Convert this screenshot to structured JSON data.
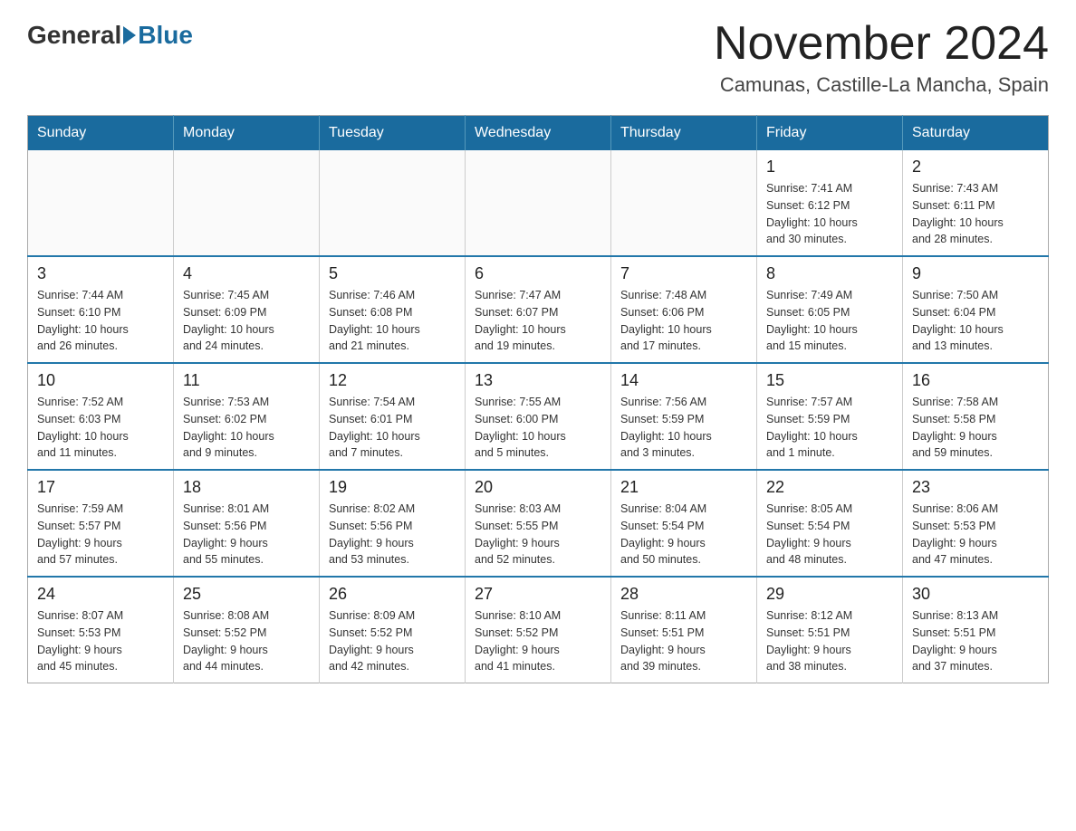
{
  "header": {
    "logo_general": "General",
    "logo_blue": "Blue",
    "month_title": "November 2024",
    "location": "Camunas, Castille-La Mancha, Spain"
  },
  "weekdays": [
    "Sunday",
    "Monday",
    "Tuesday",
    "Wednesday",
    "Thursday",
    "Friday",
    "Saturday"
  ],
  "weeks": [
    [
      {
        "day": "",
        "info": ""
      },
      {
        "day": "",
        "info": ""
      },
      {
        "day": "",
        "info": ""
      },
      {
        "day": "",
        "info": ""
      },
      {
        "day": "",
        "info": ""
      },
      {
        "day": "1",
        "info": "Sunrise: 7:41 AM\nSunset: 6:12 PM\nDaylight: 10 hours\nand 30 minutes."
      },
      {
        "day": "2",
        "info": "Sunrise: 7:43 AM\nSunset: 6:11 PM\nDaylight: 10 hours\nand 28 minutes."
      }
    ],
    [
      {
        "day": "3",
        "info": "Sunrise: 7:44 AM\nSunset: 6:10 PM\nDaylight: 10 hours\nand 26 minutes."
      },
      {
        "day": "4",
        "info": "Sunrise: 7:45 AM\nSunset: 6:09 PM\nDaylight: 10 hours\nand 24 minutes."
      },
      {
        "day": "5",
        "info": "Sunrise: 7:46 AM\nSunset: 6:08 PM\nDaylight: 10 hours\nand 21 minutes."
      },
      {
        "day": "6",
        "info": "Sunrise: 7:47 AM\nSunset: 6:07 PM\nDaylight: 10 hours\nand 19 minutes."
      },
      {
        "day": "7",
        "info": "Sunrise: 7:48 AM\nSunset: 6:06 PM\nDaylight: 10 hours\nand 17 minutes."
      },
      {
        "day": "8",
        "info": "Sunrise: 7:49 AM\nSunset: 6:05 PM\nDaylight: 10 hours\nand 15 minutes."
      },
      {
        "day": "9",
        "info": "Sunrise: 7:50 AM\nSunset: 6:04 PM\nDaylight: 10 hours\nand 13 minutes."
      }
    ],
    [
      {
        "day": "10",
        "info": "Sunrise: 7:52 AM\nSunset: 6:03 PM\nDaylight: 10 hours\nand 11 minutes."
      },
      {
        "day": "11",
        "info": "Sunrise: 7:53 AM\nSunset: 6:02 PM\nDaylight: 10 hours\nand 9 minutes."
      },
      {
        "day": "12",
        "info": "Sunrise: 7:54 AM\nSunset: 6:01 PM\nDaylight: 10 hours\nand 7 minutes."
      },
      {
        "day": "13",
        "info": "Sunrise: 7:55 AM\nSunset: 6:00 PM\nDaylight: 10 hours\nand 5 minutes."
      },
      {
        "day": "14",
        "info": "Sunrise: 7:56 AM\nSunset: 5:59 PM\nDaylight: 10 hours\nand 3 minutes."
      },
      {
        "day": "15",
        "info": "Sunrise: 7:57 AM\nSunset: 5:59 PM\nDaylight: 10 hours\nand 1 minute."
      },
      {
        "day": "16",
        "info": "Sunrise: 7:58 AM\nSunset: 5:58 PM\nDaylight: 9 hours\nand 59 minutes."
      }
    ],
    [
      {
        "day": "17",
        "info": "Sunrise: 7:59 AM\nSunset: 5:57 PM\nDaylight: 9 hours\nand 57 minutes."
      },
      {
        "day": "18",
        "info": "Sunrise: 8:01 AM\nSunset: 5:56 PM\nDaylight: 9 hours\nand 55 minutes."
      },
      {
        "day": "19",
        "info": "Sunrise: 8:02 AM\nSunset: 5:56 PM\nDaylight: 9 hours\nand 53 minutes."
      },
      {
        "day": "20",
        "info": "Sunrise: 8:03 AM\nSunset: 5:55 PM\nDaylight: 9 hours\nand 52 minutes."
      },
      {
        "day": "21",
        "info": "Sunrise: 8:04 AM\nSunset: 5:54 PM\nDaylight: 9 hours\nand 50 minutes."
      },
      {
        "day": "22",
        "info": "Sunrise: 8:05 AM\nSunset: 5:54 PM\nDaylight: 9 hours\nand 48 minutes."
      },
      {
        "day": "23",
        "info": "Sunrise: 8:06 AM\nSunset: 5:53 PM\nDaylight: 9 hours\nand 47 minutes."
      }
    ],
    [
      {
        "day": "24",
        "info": "Sunrise: 8:07 AM\nSunset: 5:53 PM\nDaylight: 9 hours\nand 45 minutes."
      },
      {
        "day": "25",
        "info": "Sunrise: 8:08 AM\nSunset: 5:52 PM\nDaylight: 9 hours\nand 44 minutes."
      },
      {
        "day": "26",
        "info": "Sunrise: 8:09 AM\nSunset: 5:52 PM\nDaylight: 9 hours\nand 42 minutes."
      },
      {
        "day": "27",
        "info": "Sunrise: 8:10 AM\nSunset: 5:52 PM\nDaylight: 9 hours\nand 41 minutes."
      },
      {
        "day": "28",
        "info": "Sunrise: 8:11 AM\nSunset: 5:51 PM\nDaylight: 9 hours\nand 39 minutes."
      },
      {
        "day": "29",
        "info": "Sunrise: 8:12 AM\nSunset: 5:51 PM\nDaylight: 9 hours\nand 38 minutes."
      },
      {
        "day": "30",
        "info": "Sunrise: 8:13 AM\nSunset: 5:51 PM\nDaylight: 9 hours\nand 37 minutes."
      }
    ]
  ]
}
